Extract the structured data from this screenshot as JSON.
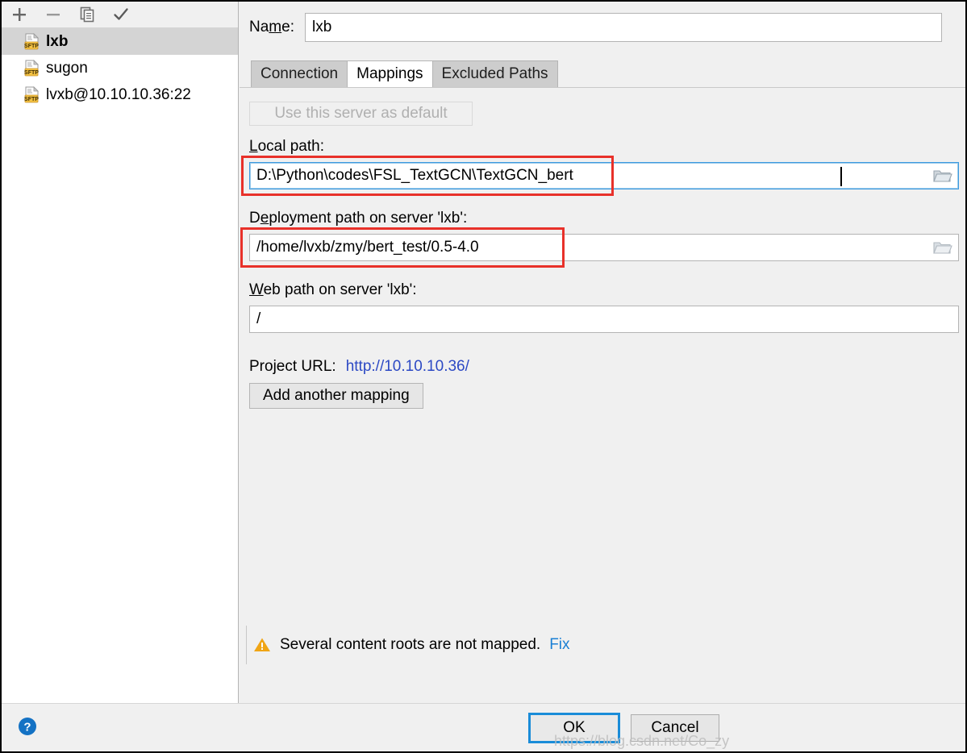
{
  "toolbar": {
    "buttons": [
      {
        "name": "add-server-button",
        "icon": "plus-icon",
        "label": "+"
      },
      {
        "name": "remove-server-button",
        "icon": "minus-icon",
        "label": "−"
      },
      {
        "name": "copy-server-button",
        "icon": "copy-icon",
        "label": "Copy"
      },
      {
        "name": "set-default-button",
        "icon": "check-icon",
        "label": "✓"
      }
    ]
  },
  "server_list": {
    "items": [
      {
        "label": "lxb",
        "icon": "sftp-icon",
        "selected": true
      },
      {
        "label": "sugon",
        "icon": "sftp-icon",
        "selected": false
      },
      {
        "label": "lvxb@10.10.10.36:22",
        "icon": "sftp-icon",
        "selected": false
      }
    ]
  },
  "name_field": {
    "label_pre": "Na",
    "label_mnemonic": "m",
    "label_post": "e:",
    "value": "lxb",
    "placeholder": ""
  },
  "tabs": [
    {
      "label": "Connection",
      "active": false
    },
    {
      "label": "Mappings",
      "active": true
    },
    {
      "label": "Excluded Paths",
      "active": false
    }
  ],
  "mappings": {
    "use_default_button": "Use this server as default",
    "local_path": {
      "label_mnemonic": "L",
      "label_rest": "ocal path:",
      "value": "D:\\Python\\codes\\FSL_TextGCN\\TextGCN_bert",
      "placeholder": "",
      "browse_icon": "folder-icon",
      "focused": true,
      "highlighted": true
    },
    "deployment_path": {
      "label_pre": "D",
      "label_mnemonic": "e",
      "label_post": "ployment path on server 'lxb':",
      "value": "/home/lvxb/zmy/bert_test/0.5-4.0",
      "placeholder": "",
      "browse_icon": "folder-icon",
      "focused": false,
      "highlighted": true
    },
    "web_path": {
      "label_mnemonic": "W",
      "label_rest": "eb path on server 'lxb':",
      "value": "/",
      "placeholder": "",
      "focused": false,
      "highlighted": false
    },
    "project_url": {
      "label": "Project URL:",
      "url": "http://10.10.10.36/"
    },
    "add_another_mapping": "Add another mapping"
  },
  "warning": {
    "icon": "warning-triangle-icon",
    "text": "Several content roots are not mapped.",
    "fix_label": "Fix"
  },
  "bottom_bar": {
    "help_icon": "help-circle-icon",
    "ok_label": "OK",
    "cancel_label": "Cancel"
  },
  "watermark": "https://blog.csdn.net/Co_zy",
  "colors": {
    "accent_blue": "#1a8cd8",
    "link_blue": "#2c49c4",
    "fix_blue": "#1a7fd4",
    "highlight_red": "#e8312a",
    "warning_orange": "#f0a515",
    "sftp_badge": "#f5c343",
    "panel_bg": "#f0f0f0",
    "selection_gray": "#d4d4d4"
  }
}
